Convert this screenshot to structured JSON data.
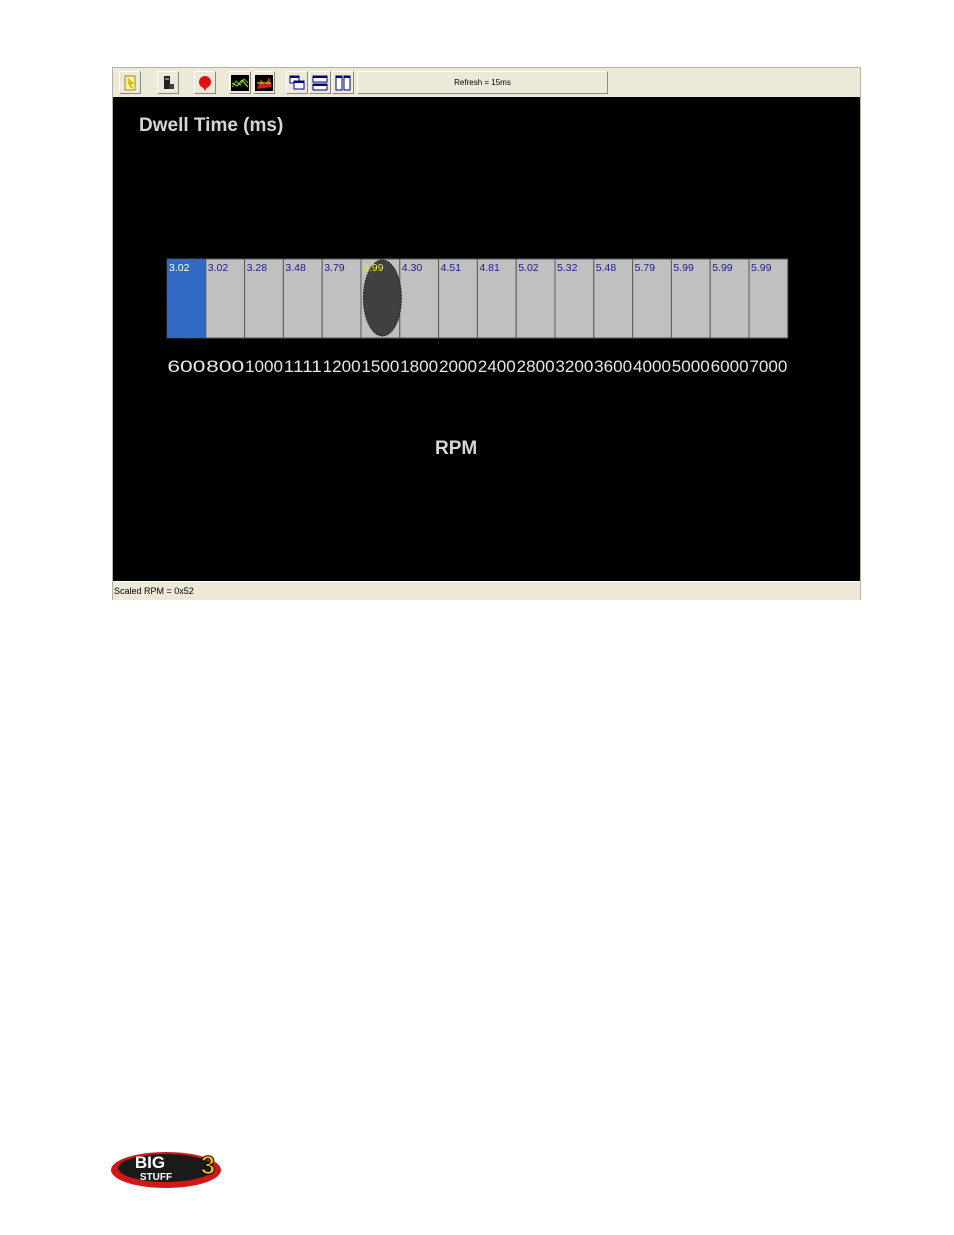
{
  "toolbar": {
    "buttons": [
      {
        "name": "open-icon",
        "icon": "open-file-icon"
      },
      {
        "name": "device-icon",
        "icon": "ecu-device-icon"
      },
      {
        "name": "stop-icon",
        "icon": "red-marker-icon"
      },
      {
        "name": "graph-icon",
        "icon": "line-graph-icon"
      },
      {
        "name": "map-icon",
        "icon": "fuel-map-icon"
      },
      {
        "name": "cascade-icon",
        "icon": "cascade-windows-icon"
      },
      {
        "name": "tile-horizontal-icon",
        "icon": "tile-horizontal-icon"
      },
      {
        "name": "tile-vertical-icon",
        "icon": "tile-vertical-icon"
      }
    ],
    "refresh_label": "Refresh = 15ms"
  },
  "statusbar": {
    "text": "Scaled RPM = 0x52"
  },
  "logo": {
    "text_top": "BIG",
    "text_bottom": "STUFF",
    "number": "3"
  },
  "colors": {
    "background": "#000000",
    "cell": "#c0c0c0",
    "cell_selected": "#316ac5",
    "cell_value": "#1c1c8c",
    "cell_value_selected": "#ffffff",
    "cell_value_highlight": "#e8e84a",
    "cursor": "#404040",
    "label": "#e6e6e6"
  },
  "chart_data": {
    "type": "table",
    "title": "Dwell Time (ms)",
    "xlabel": "RPM",
    "ylabel": "",
    "categories": [
      "600",
      "800",
      "1000",
      "1111",
      "1200",
      "1500",
      "1800",
      "2000",
      "2400",
      "2800",
      "3200",
      "3600",
      "4000",
      "5000",
      "6000",
      "7000"
    ],
    "values": [
      "3.02",
      "3.02",
      "3.28",
      "3.48",
      "3.79",
      "3.99",
      "4.30",
      "4.51",
      "4.81",
      "5.02",
      "5.32",
      "5.48",
      "5.79",
      "5.99",
      "5.99",
      "5.99"
    ],
    "selected_index": 0,
    "highlight_index": 5,
    "cursor_index": 5
  }
}
